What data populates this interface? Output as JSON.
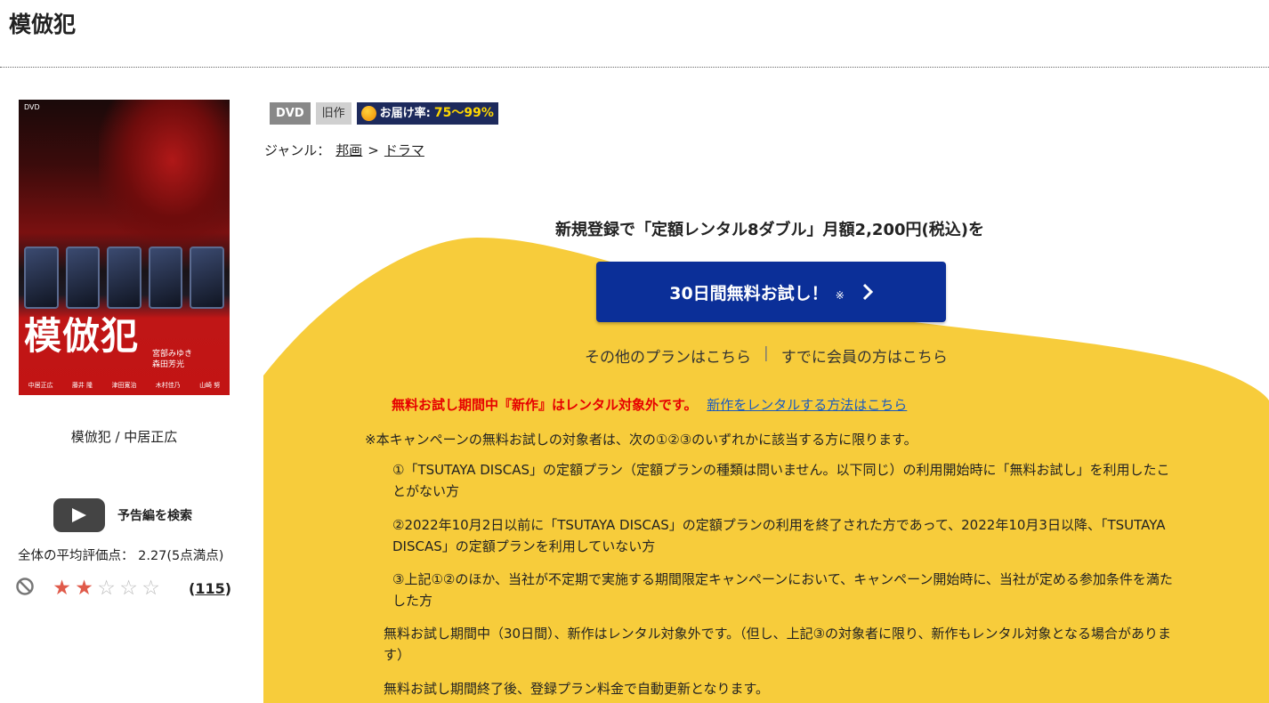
{
  "page": {
    "title": "模倣犯"
  },
  "cover": {
    "title_text": "模倣犯",
    "dvd_mark": "DVD",
    "staff": [
      "宮部みゆき",
      "森田芳光"
    ],
    "cast": [
      "中居正広",
      "藤井 隆",
      "津田寛治",
      "木村佳乃",
      "山崎 努"
    ]
  },
  "caption": "模倣犯 / 中居正広",
  "trailer": {
    "label": "予告編を検索"
  },
  "rating": {
    "average_label": "全体の平均評価点：",
    "average_value": "2.27(5点満点)",
    "stars_filled": 2,
    "stars_total": 5,
    "review_count": "115",
    "colors": {
      "star_filled": "#e05a4a",
      "star_empty": "#bbbbbb"
    }
  },
  "badges": {
    "dvd": "DVD",
    "old": "旧作",
    "delivery_label": "お届け率:",
    "delivery_rate": "75～99%"
  },
  "genre": {
    "label": "ジャンル：",
    "crumbs": [
      "邦画",
      "ドラマ"
    ],
    "separator": ">"
  },
  "campaign": {
    "headline": "新規登録で「定額レンタル8ダブル」月額2,200円(税込)を",
    "trial_button": "30日間無料お試し！",
    "trial_mark": "※",
    "other_plans": "その他のプランはこちら",
    "separator": "|",
    "members": "すでに会員の方はこちら",
    "notice_red": "無料お試し期間中『新作』はレンタル対象外です。",
    "notice_link": "新作をレンタルする方法はこちら",
    "terms": [
      "※本キャンペーンの無料お試しの対象者は、次の①②③のいずれかに該当する方に限ります。",
      "①「TSUTAYA DISCAS」の定額プラン（定額プランの種類は問いません。以下同じ）の利用開始時に「無料お試し」を利用したことがない方",
      "②2022年10月2日以前に「TSUTAYA DISCAS」の定額プランの利用を終了された方であって、2022年10月3日以降、「TSUTAYA DISCAS」の定額プランを利用していない方",
      "③上記①②のほか、当社が不定期で実施する期間限定キャンペーンにおいて、キャンペーン開始時に、当社が定める参加条件を満たした方",
      "無料お試し期間中（30日間）、新作はレンタル対象外です。（但し、上記③の対象者に限り、新作もレンタル対象となる場合があります）",
      "無料お試し期間終了後、登録プラン料金で自動更新となります。"
    ],
    "colors": {
      "background": "#f7cc3b",
      "button": "#0b2f98",
      "notice": "#e60000",
      "link": "#1c5bbd"
    }
  }
}
